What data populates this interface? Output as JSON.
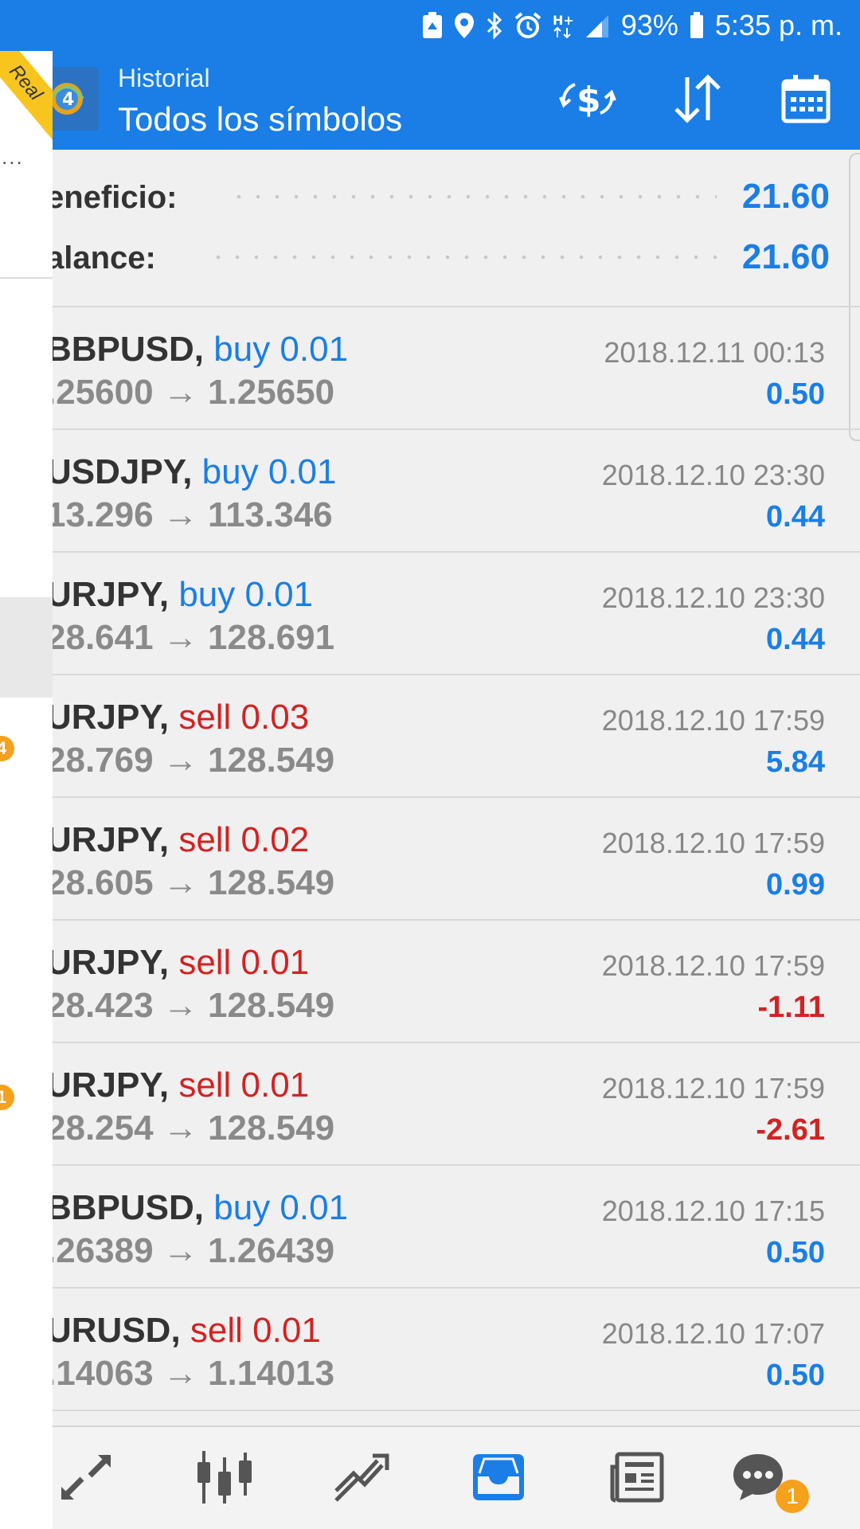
{
  "status_bar": {
    "battery_percent": "93%",
    "time": "5:35 p. m.",
    "icons": [
      "recycle-icon",
      "location-icon",
      "bluetooth-icon",
      "alarm-icon",
      "hplus-data-icon",
      "signal-icon",
      "battery-icon"
    ]
  },
  "drawer": {
    "badge_top": "4",
    "badge_bottom": "1",
    "real_label": "Real",
    "ellipsis": "..."
  },
  "header": {
    "subtitle": "Historial",
    "title": "Todos los símbolos",
    "actions": [
      "deposit-withdraw-icon",
      "sort-icon",
      "calendar-icon"
    ]
  },
  "summary": {
    "profit_label": "eneficio:",
    "profit_value": "21.60",
    "balance_label": "alance:",
    "balance_value": "21.60"
  },
  "trades": [
    {
      "symbol": "BBPUSD,",
      "side": "buy 0.01",
      "side_type": "buy",
      "prices": ".25600 → 1.25650",
      "time": "2018.12.11 00:13",
      "profit": "0.50",
      "profit_sign": "pos"
    },
    {
      "symbol": "USDJPY,",
      "side": "buy 0.01",
      "side_type": "buy",
      "prices": "13.296 → 113.346",
      "time": "2018.12.10 23:30",
      "profit": "0.44",
      "profit_sign": "pos"
    },
    {
      "symbol": "URJPY,",
      "side": "buy 0.01",
      "side_type": "buy",
      "prices": "28.641 → 128.691",
      "time": "2018.12.10 23:30",
      "profit": "0.44",
      "profit_sign": "pos"
    },
    {
      "symbol": "URJPY,",
      "side": "sell 0.03",
      "side_type": "sell",
      "prices": "28.769 → 128.549",
      "time": "2018.12.10 17:59",
      "profit": "5.84",
      "profit_sign": "pos"
    },
    {
      "symbol": "URJPY,",
      "side": "sell 0.02",
      "side_type": "sell",
      "prices": "28.605 → 128.549",
      "time": "2018.12.10 17:59",
      "profit": "0.99",
      "profit_sign": "pos"
    },
    {
      "symbol": "URJPY,",
      "side": "sell 0.01",
      "side_type": "sell",
      "prices": "28.423 → 128.549",
      "time": "2018.12.10 17:59",
      "profit": "-1.11",
      "profit_sign": "neg"
    },
    {
      "symbol": "URJPY,",
      "side": "sell 0.01",
      "side_type": "sell",
      "prices": "28.254 → 128.549",
      "time": "2018.12.10 17:59",
      "profit": "-2.61",
      "profit_sign": "neg"
    },
    {
      "symbol": "BBPUSD,",
      "side": "buy 0.01",
      "side_type": "buy",
      "prices": ".26389 → 1.26439",
      "time": "2018.12.10 17:15",
      "profit": "0.50",
      "profit_sign": "pos"
    },
    {
      "symbol": "URUSD,",
      "side": "sell 0.01",
      "side_type": "sell",
      "prices": ".14063 → 1.14013",
      "time": "2018.12.10 17:07",
      "profit": "0.50",
      "profit_sign": "pos"
    }
  ],
  "bottom_nav": {
    "items": [
      "quotes-icon",
      "chart-icon",
      "trade-icon",
      "history-icon",
      "news-icon",
      "chat-icon"
    ],
    "active": "history-icon",
    "chat_badge": "1"
  },
  "colors": {
    "accent": "#1a7ee6",
    "sell": "#d32222",
    "badge": "#f5a11c",
    "ribbon": "#f7c51e"
  }
}
